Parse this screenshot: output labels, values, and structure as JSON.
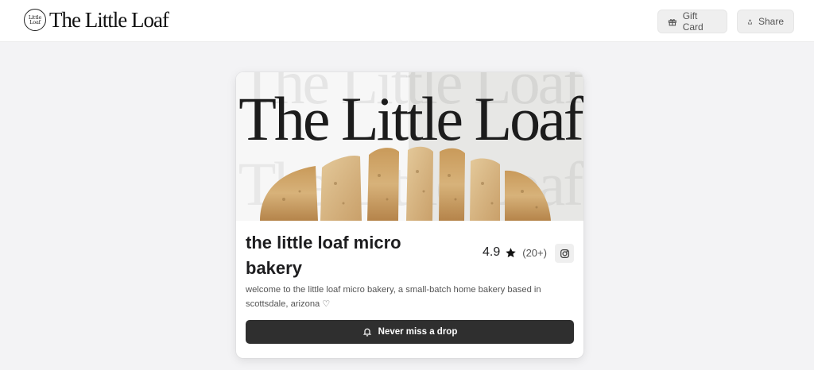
{
  "header": {
    "brand_badge_line1": "Little",
    "brand_badge_line2": "Loaf",
    "brand_name": "The Little Loaf",
    "gift_card_label": "Gift Card",
    "share_label": "Share"
  },
  "banner": {
    "title": "The Little Loaf"
  },
  "shop": {
    "name": "the little loaf micro bakery",
    "rating": "4.9",
    "review_count": "(20+)",
    "description": "welcome to the little loaf micro bakery, a small-batch home bakery based in scottsdale, arizona ♡",
    "cta_label": "Never miss a drop"
  },
  "colors": {
    "page_bg": "#f3f3f5",
    "cta_bg": "#2f2f2f",
    "button_bg": "#efefef"
  },
  "icons": {
    "gift": "gift-icon",
    "share": "share-icon",
    "star": "star-icon",
    "instagram": "instagram-icon",
    "bell": "bell-icon"
  }
}
